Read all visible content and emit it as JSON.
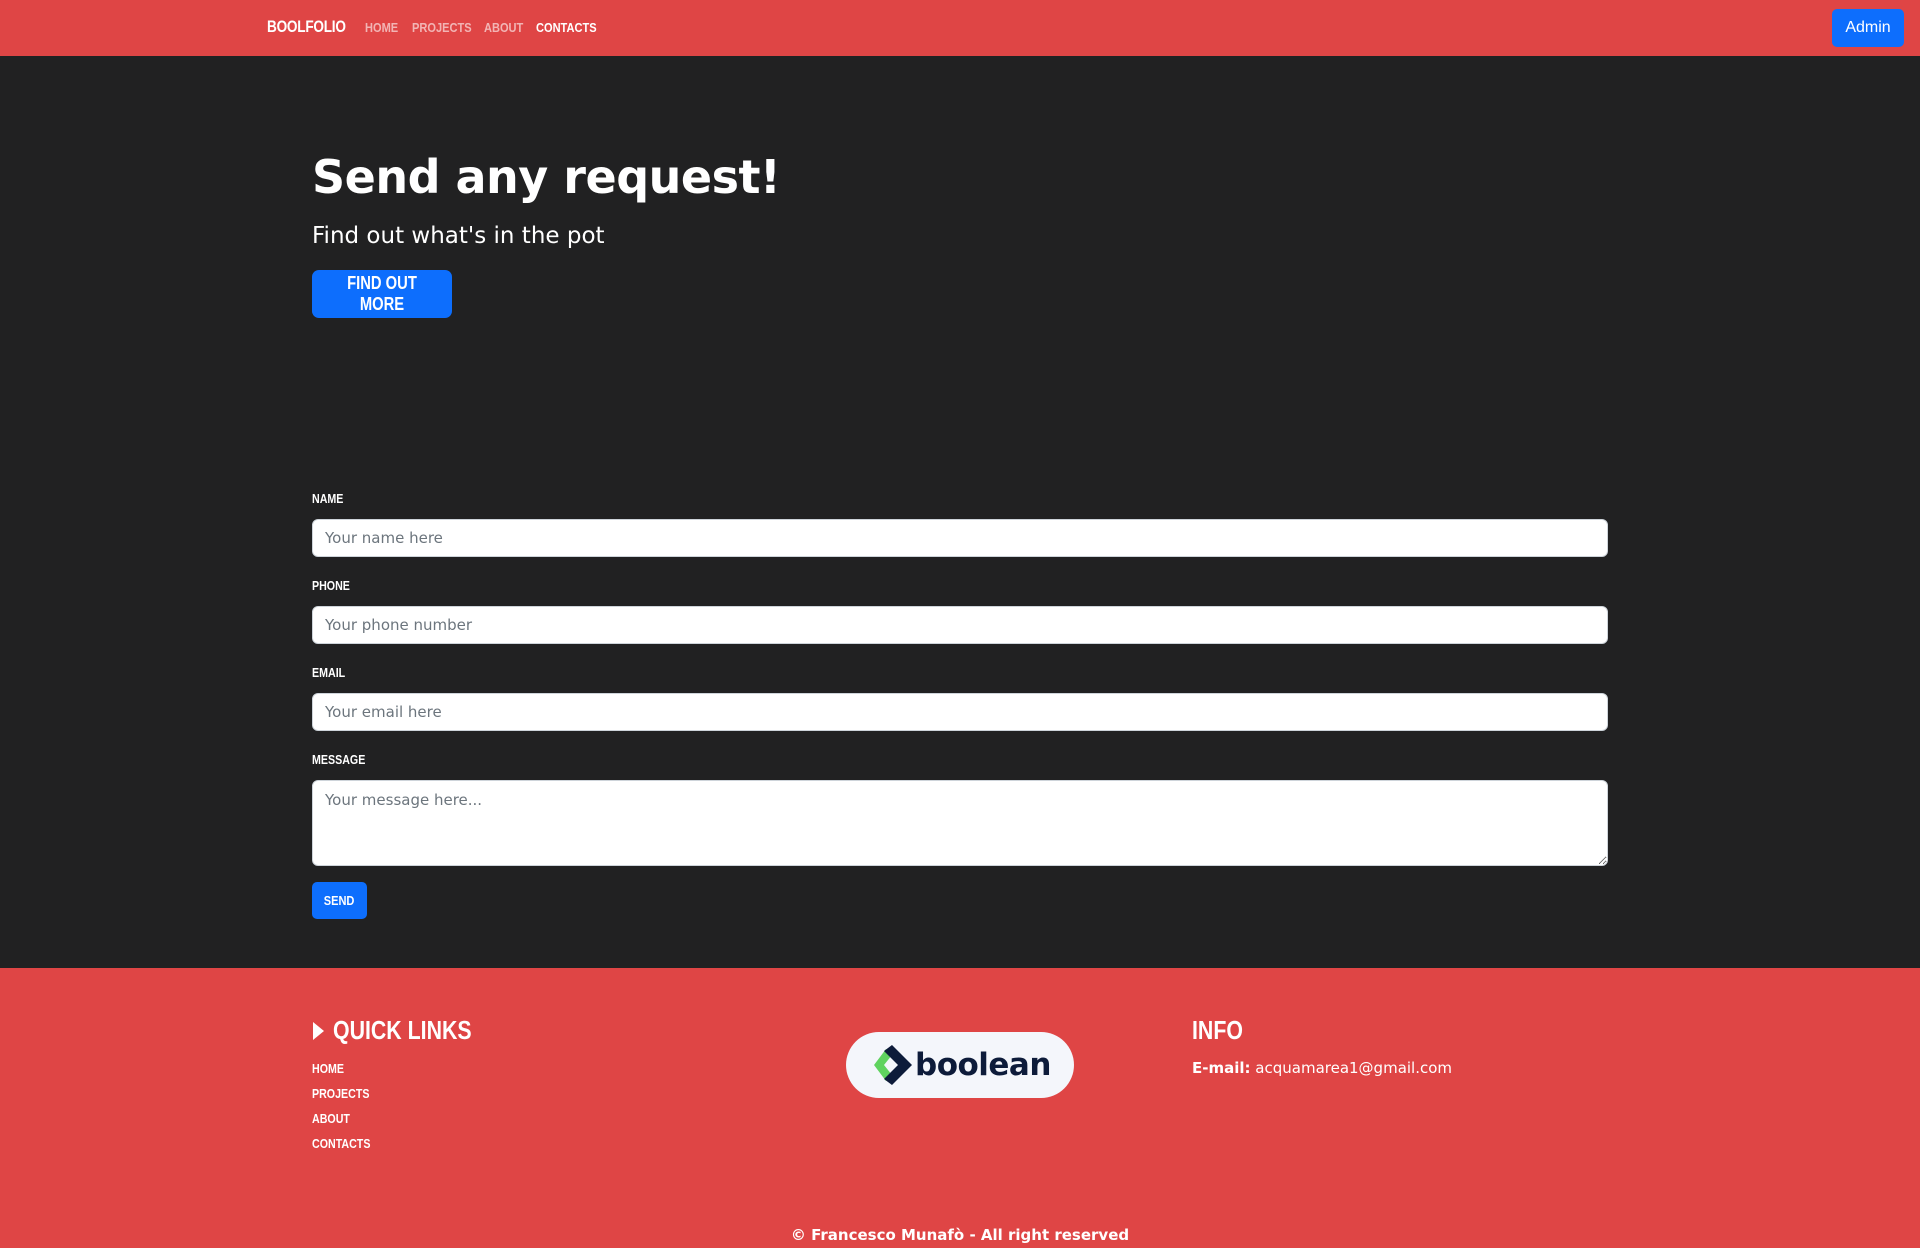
{
  "navbar": {
    "brand": "BOOLFOLIO",
    "links": [
      {
        "label": "HOME",
        "active": false
      },
      {
        "label": "PROJECTS",
        "active": false
      },
      {
        "label": "ABOUT",
        "active": false
      },
      {
        "label": "CONTACTS",
        "active": true
      }
    ],
    "admin_label": "Admin"
  },
  "hero": {
    "title": "Send any request!",
    "subtitle": "Find out what's in the pot",
    "button_label": "FIND OUT MORE"
  },
  "form": {
    "name": {
      "label": "NAME",
      "placeholder": "Your name here",
      "value": ""
    },
    "phone": {
      "label": "PHONE",
      "placeholder": "Your phone number",
      "value": ""
    },
    "email": {
      "label": "EMAIL",
      "placeholder": "Your email here",
      "value": ""
    },
    "message": {
      "label": "MESSAGE",
      "placeholder": "Your message here...",
      "value": ""
    },
    "send_label": "SEND"
  },
  "footer": {
    "quick_links_title": "QUICK LINKS",
    "quick_links": [
      "HOME",
      "PROJECTS",
      "ABOUT",
      "CONTACTS"
    ],
    "logo_text": "boolean",
    "info_title": "INFO",
    "email_label": "E-mail:",
    "email_value": "acquamarea1@gmail.com",
    "copyright": "© Francesco Munafò - All right reserved"
  },
  "colors": {
    "navbar_bg": "#df4545",
    "page_bg": "#212122",
    "primary": "#0d6efd",
    "logo_green": "#5fd35f",
    "logo_navy": "#0d1b3a"
  }
}
